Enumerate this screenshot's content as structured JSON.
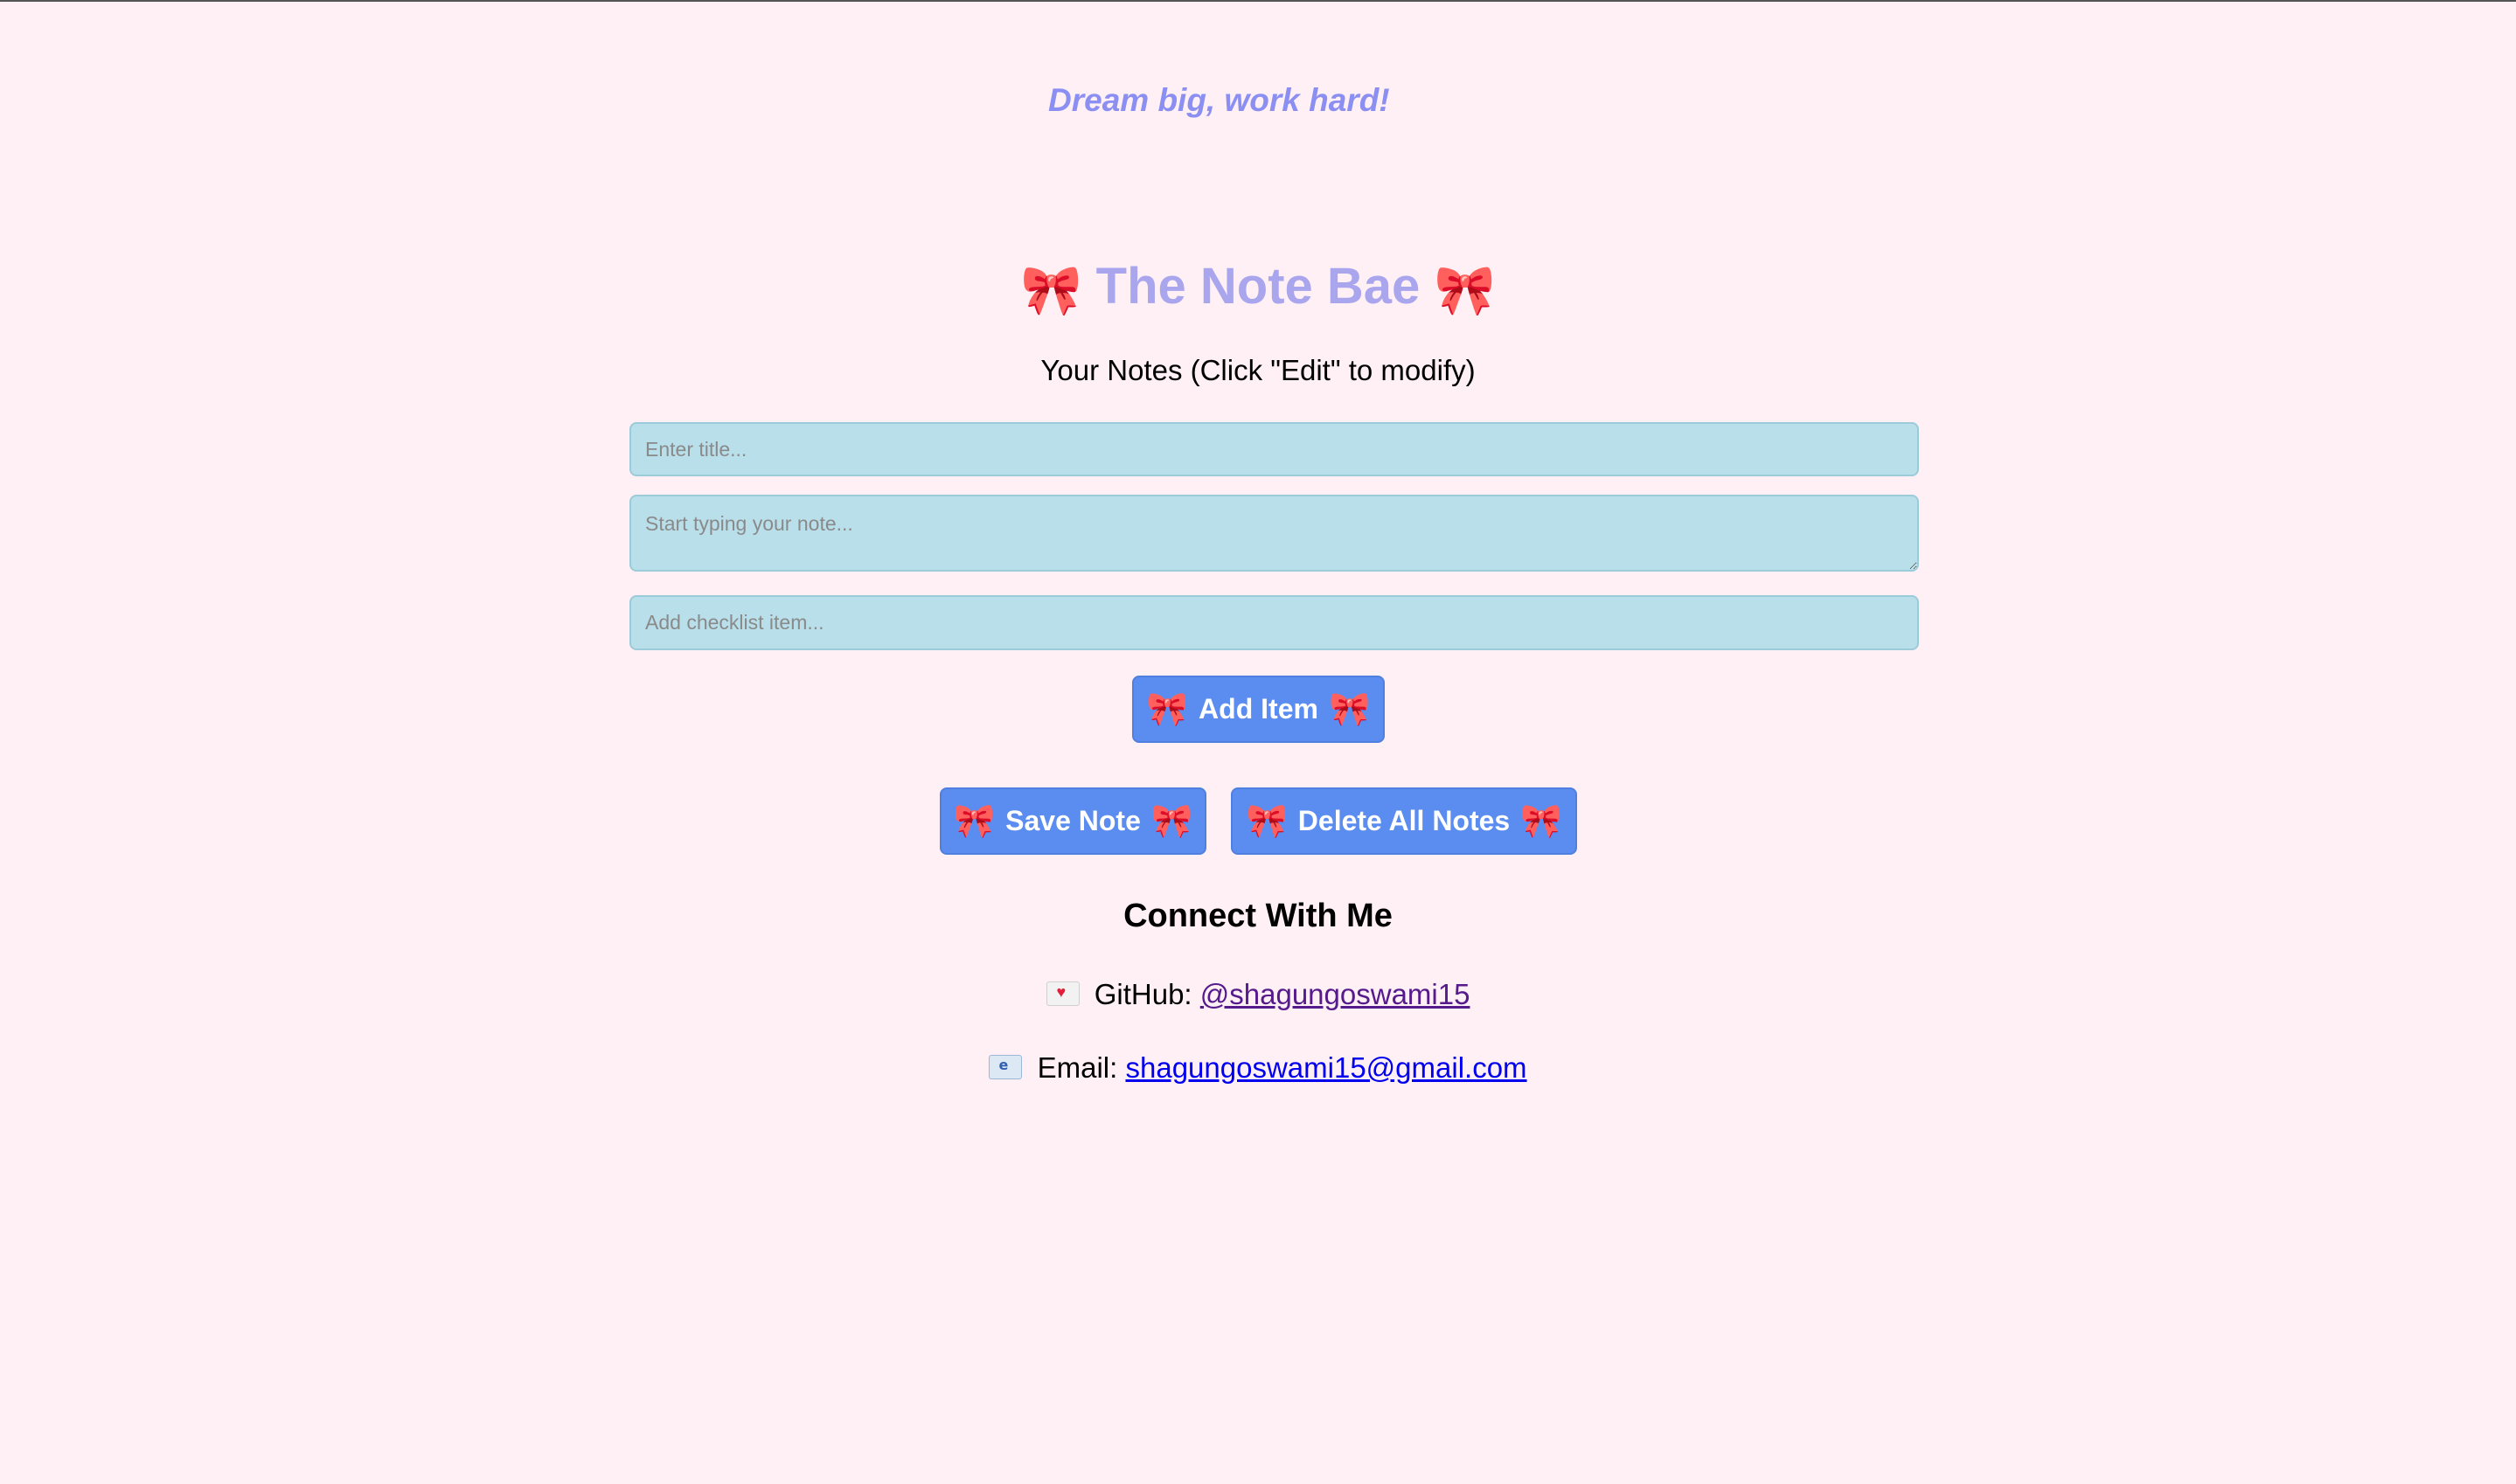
{
  "quote": "Dream big, work hard!",
  "app": {
    "title": "The Note Bae",
    "title_icon": "bow-icon",
    "subtitle": "Your Notes (Click \"Edit\" to modify)"
  },
  "form": {
    "title_placeholder": "Enter title...",
    "note_placeholder": "Start typing your note...",
    "checklist_placeholder": "Add checklist item..."
  },
  "buttons": {
    "add_item": "Add Item",
    "save_note": "Save Note",
    "delete_all": "Delete All Notes"
  },
  "connect": {
    "heading": "Connect With Me",
    "github_label": "GitHub:",
    "github_handle": "@shagungoswami15",
    "github_icon": "love-letter-icon",
    "email_label": "Email:",
    "email_address": "shagungoswami15@gmail.com",
    "email_icon": "e-mail-icon"
  },
  "colors": {
    "background": "#fff0f5",
    "title": "#a9a6ee",
    "quote": "#8b8ff2",
    "input_bg": "#b8dfea",
    "button_bg": "#5b8df0",
    "bow": "#ea5c8e"
  }
}
